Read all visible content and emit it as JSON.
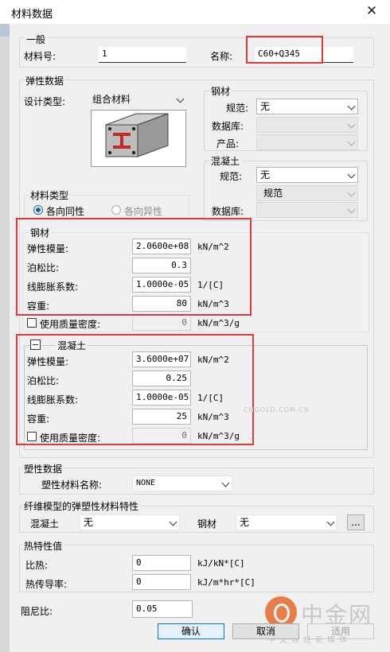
{
  "window": {
    "title": "材料数据",
    "close_glyph": "✕"
  },
  "general": {
    "group_label": "一般",
    "material_no_label": "材料号:",
    "material_no_value": "1",
    "name_label": "名称:",
    "name_value": "C60+Q345"
  },
  "elastic": {
    "group_label": "弹性数据",
    "design_type_label": "设计类型:",
    "design_type_value": "组合材料",
    "material_type_label": "材料类型",
    "radio_iso": "各向同性",
    "radio_aniso": "各向异性",
    "steel_group": {
      "label": "钢材",
      "spec_label": "规范:",
      "spec_value": "无",
      "db_label": "数据库:",
      "db_value": "",
      "product_label": "产品:",
      "product_value": ""
    },
    "concrete_group": {
      "label": "混凝土",
      "spec_label": "规范:",
      "spec_value": "无",
      "spec2_label": "规范",
      "db_label": "数据库:",
      "db_value": ""
    }
  },
  "steel": {
    "group_label": "钢材",
    "modulus_label": "弹性模量:",
    "modulus_value": "2.0600e+08",
    "modulus_unit": "kN/m^2",
    "poisson_label": "泊松比:",
    "poisson_value": "0.3",
    "thermal_label": "线膨胀系数:",
    "thermal_value": "1.0000e-05",
    "thermal_unit": "1/[C]",
    "weight_label": "容重:",
    "weight_value": "80",
    "weight_unit": "kN/m^3",
    "mass_label": "使用质量密度:",
    "mass_value": "0",
    "mass_unit": "kN/m^3/g"
  },
  "concrete": {
    "group_label": "混凝土",
    "modulus_label": "弹性模量:",
    "modulus_value": "3.6000e+07",
    "modulus_unit": "kN/m^2",
    "poisson_label": "泊松比:",
    "poisson_value": "0.25",
    "thermal_label": "线膨胀系数:",
    "thermal_value": "1.0000e-05",
    "thermal_unit": "1/[C]",
    "weight_label": "容重:",
    "weight_value": "25",
    "weight_unit": "kN/m^3",
    "mass_label": "使用质量密度:",
    "mass_value": "0",
    "mass_unit": "kN/m^3/g"
  },
  "plastic": {
    "group_label": "塑性数据",
    "name_label": "塑性材料名称:",
    "name_value": "NONE"
  },
  "fiber": {
    "group_label": "纤维模型的弹塑性材料特性",
    "concrete_label": "混凝土",
    "concrete_value": "无",
    "steel_label": "钢材",
    "steel_value": "无",
    "more_button": "..."
  },
  "thermal": {
    "group_label": "热特性值",
    "specific_heat_label": "比热:",
    "specific_heat_value": "0",
    "specific_heat_unit": "kJ/kN*[C]",
    "conductivity_label": "热传导率:",
    "conductivity_value": "0",
    "conductivity_unit": "kJ/m*hr*[C]"
  },
  "damping": {
    "label": "阻尼比:",
    "value": "0.05"
  },
  "buttons": {
    "ok": "确认",
    "cancel": "取消",
    "apply": "适用"
  },
  "watermark": {
    "brand": "中金网",
    "slogan": "中文财经新媒体",
    "url": "CNGOLD.COM.CN"
  },
  "colors": {
    "highlight": "#e03a3a",
    "section_red": "#c62828",
    "accent": "#1e5aa8"
  }
}
